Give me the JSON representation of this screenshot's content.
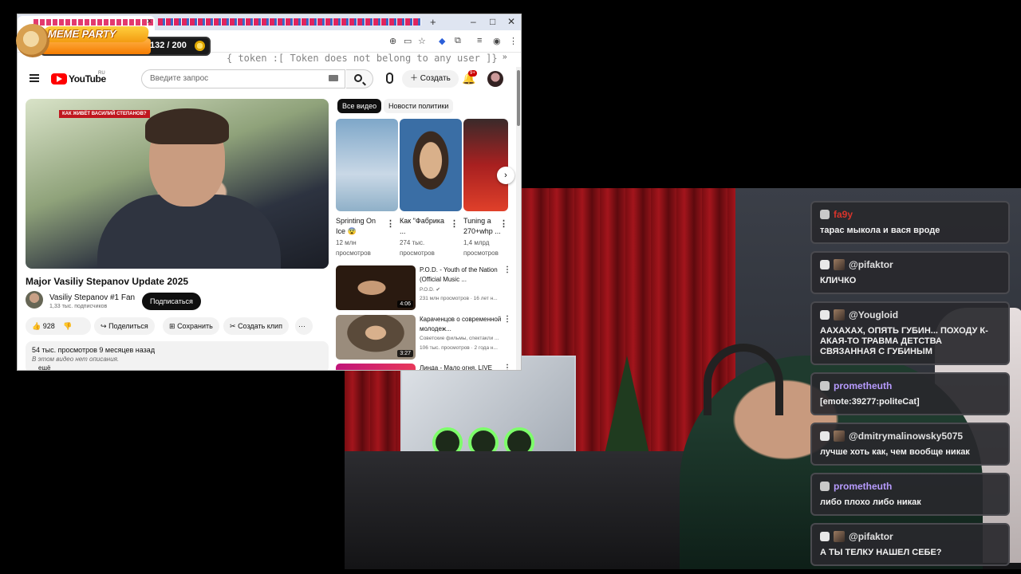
{
  "browser": {
    "tab_close": "×",
    "new_tab": "+",
    "win_min": "–",
    "win_max": "□",
    "win_close": "✕",
    "bookmarks_more": "»",
    "token_overlay": "{ token :[ Token does not belong to any user ]}"
  },
  "meme_party": {
    "title": "MEME PARTY",
    "count": "132 / 200",
    "progress": 0.66
  },
  "youtube": {
    "logo": "YouTube",
    "logo_suffix": "RU",
    "search_placeholder": "Введите запрос",
    "create_label": "Создать",
    "notifications_badge": "9+",
    "video": {
      "overlay_tag": "КАК ЖИВЁТ ВАСИЛИЙ СТЕПАНОВ?",
      "title": "Major Vasiliy Stepanov Update 2025",
      "channel": "Vasiliy Stepanov #1 Fan",
      "subscribers": "1,33 тыс. подписчиков",
      "subscribe": "Подписаться",
      "likes": "928",
      "share": "Поделиться",
      "save": "Сохранить",
      "clip": "Создать клип",
      "more": "···",
      "views_date": "54 тыс. просмотров  9 месяцев назад",
      "no_description": "В этом видео нет описания.",
      "more_link": "ещё"
    },
    "chips": [
      "Все видео",
      "Новости политики"
    ],
    "shorts": [
      {
        "title": "Sprinting On Ice 😨",
        "views": "12 млн просмотров"
      },
      {
        "title": "Как \"Фабрика ...",
        "views": "274 тыс. просмотров"
      },
      {
        "title": "Tuning a 270+whp ...",
        "views": "1,4 млрд просмотров"
      }
    ],
    "recommendations": [
      {
        "title": "P.O.D. - Youth of the Nation (Official Music ...",
        "channel": "P.O.D. ✔",
        "meta": "231 млн просмотров · 16 лет н...",
        "duration": "4:06"
      },
      {
        "title": "Караченцов о современной молодеж...",
        "channel": "Советские фильмы, спектакли ...",
        "meta": "106 тыс. просмотров · 2 года н...",
        "duration": "3:27"
      },
      {
        "title": "Линда - Мало огня, LIVE",
        "channel": "",
        "meta": "",
        "duration": ""
      }
    ]
  },
  "chat": [
    {
      "user": "fa9y",
      "color": "#d9342b",
      "badge": "icon",
      "text": "тарас мыкола и вася вроде"
    },
    {
      "user": "@pifaktor",
      "color": "#e0e0e0",
      "badge": "avatar",
      "text": "КЛИЧКО"
    },
    {
      "user": "@Yougloid",
      "color": "#e0e0e0",
      "badge": "avatar",
      "text": "ААХАХАХ, ОПЯТЬ ГУБИН... ПОХОДУ К-АКАЯ-ТО ТРАВМА ДЕТСТВА СВЯЗАННАЯ С ГУБИНЫМ"
    },
    {
      "user": "prometheuth",
      "color": "#b79bff",
      "badge": "icon",
      "text": "[emote:39277:politeCat]"
    },
    {
      "user": "@dmitrymalinowsky5075",
      "color": "#e0e0e0",
      "badge": "avatar",
      "text": "лучше хоть как, чем вообще никак"
    },
    {
      "user": "prometheuth",
      "color": "#b79bff",
      "badge": "icon",
      "text": "либо плохо либо никак"
    },
    {
      "user": "@pifaktor",
      "color": "#e0e0e0",
      "badge": "avatar",
      "text": "А ТЫ ТЕЛКУ НАШЕЛ СЕБЕ?"
    }
  ]
}
